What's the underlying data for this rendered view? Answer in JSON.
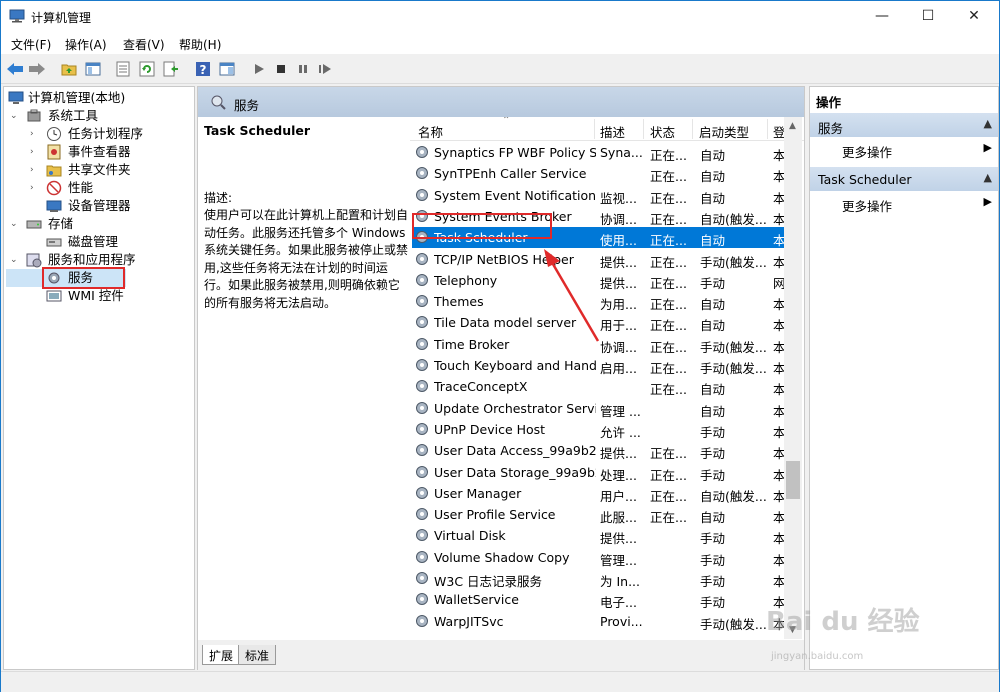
{
  "window": {
    "title": "计算机管理",
    "minimize": "—",
    "maximize": "☐",
    "close": "✕"
  },
  "menu": [
    "文件(F)",
    "操作(A)",
    "查看(V)",
    "帮助(H)"
  ],
  "tree": {
    "root": "计算机管理(本地)",
    "system_tools": "系统工具",
    "task_scheduler": "任务计划程序",
    "event_viewer": "事件查看器",
    "shared_folders": "共享文件夹",
    "performance": "性能",
    "device_manager": "设备管理器",
    "storage": "存储",
    "disk_management": "磁盘管理",
    "services_apps": "服务和应用程序",
    "services": "服务",
    "wmi": "WMI 控件"
  },
  "middle": {
    "header": "服务",
    "desc_title": "Task Scheduler",
    "desc_label": "描述:",
    "desc_text": "使用户可以在此计算机上配置和计划自动任务。此服务还托管多个 Windows 系统关键任务。如果此服务被停止或禁用,这些任务将无法在计划的时间运行。如果此服务被禁用,则明确依赖它的所有服务将无法启动。",
    "columns": [
      "名称",
      "描述",
      "状态",
      "启动类型",
      "登"
    ],
    "rows": [
      {
        "name": "Synaptics FP WBF Policy Se...",
        "desc": "Syna...",
        "status": "正在...",
        "startup": "自动",
        "logon": "本"
      },
      {
        "name": "SynTPEnh Caller Service",
        "desc": "",
        "status": "正在...",
        "startup": "自动",
        "logon": "本"
      },
      {
        "name": "System Event Notification ...",
        "desc": "监视...",
        "status": "正在...",
        "startup": "自动",
        "logon": "本"
      },
      {
        "name": "System Events Broker",
        "desc": "协调...",
        "status": "正在...",
        "startup": "自动(触发...",
        "logon": "本"
      },
      {
        "name": "Task Scheduler",
        "desc": "使用...",
        "status": "正在...",
        "startup": "自动",
        "logon": "本"
      },
      {
        "name": "TCP/IP NetBIOS Helper",
        "desc": "提供...",
        "status": "正在...",
        "startup": "手动(触发...",
        "logon": "本"
      },
      {
        "name": "Telephony",
        "desc": "提供...",
        "status": "正在...",
        "startup": "手动",
        "logon": "网"
      },
      {
        "name": "Themes",
        "desc": "为用...",
        "status": "正在...",
        "startup": "自动",
        "logon": "本"
      },
      {
        "name": "Tile Data model server",
        "desc": "用于...",
        "status": "正在...",
        "startup": "自动",
        "logon": "本"
      },
      {
        "name": "Time Broker",
        "desc": "协调...",
        "status": "正在...",
        "startup": "手动(触发...",
        "logon": "本"
      },
      {
        "name": "Touch Keyboard and Hand...",
        "desc": "启用...",
        "status": "正在...",
        "startup": "手动(触发...",
        "logon": "本"
      },
      {
        "name": "TraceConceptX",
        "desc": "",
        "status": "正在...",
        "startup": "自动",
        "logon": "本"
      },
      {
        "name": "Update Orchestrator Service",
        "desc": "管理 ...",
        "status": "",
        "startup": "自动",
        "logon": "本"
      },
      {
        "name": "UPnP Device Host",
        "desc": "允许 ...",
        "status": "",
        "startup": "手动",
        "logon": "本"
      },
      {
        "name": "User Data Access_99a9b25",
        "desc": "提供...",
        "status": "正在...",
        "startup": "手动",
        "logon": "本"
      },
      {
        "name": "User Data Storage_99a9b25",
        "desc": "处理...",
        "status": "正在...",
        "startup": "手动",
        "logon": "本"
      },
      {
        "name": "User Manager",
        "desc": "用户...",
        "status": "正在...",
        "startup": "自动(触发...",
        "logon": "本"
      },
      {
        "name": "User Profile Service",
        "desc": "此服...",
        "status": "正在...",
        "startup": "自动",
        "logon": "本"
      },
      {
        "name": "Virtual Disk",
        "desc": "提供...",
        "status": "",
        "startup": "手动",
        "logon": "本"
      },
      {
        "name": "Volume Shadow Copy",
        "desc": "管理...",
        "status": "",
        "startup": "手动",
        "logon": "本"
      },
      {
        "name": "W3C 日志记录服务",
        "desc": "为 In...",
        "status": "",
        "startup": "手动",
        "logon": "本"
      },
      {
        "name": "WalletService",
        "desc": "电子...",
        "status": "",
        "startup": "手动",
        "logon": "本"
      },
      {
        "name": "WarpJITSvc",
        "desc": "Provi...",
        "status": "",
        "startup": "手动(触发...",
        "logon": "本"
      }
    ],
    "tabs": [
      "扩展",
      "标准"
    ]
  },
  "actions": {
    "title": "操作",
    "section1": "服务",
    "more1": "更多操作",
    "section2": "Task Scheduler",
    "more2": "更多操作"
  },
  "watermark": {
    "main": "Bai du 经验",
    "sub": "jingyan.baidu.com"
  },
  "colors": {
    "selection": "#0078d7",
    "highlight": "#e02a2a"
  }
}
